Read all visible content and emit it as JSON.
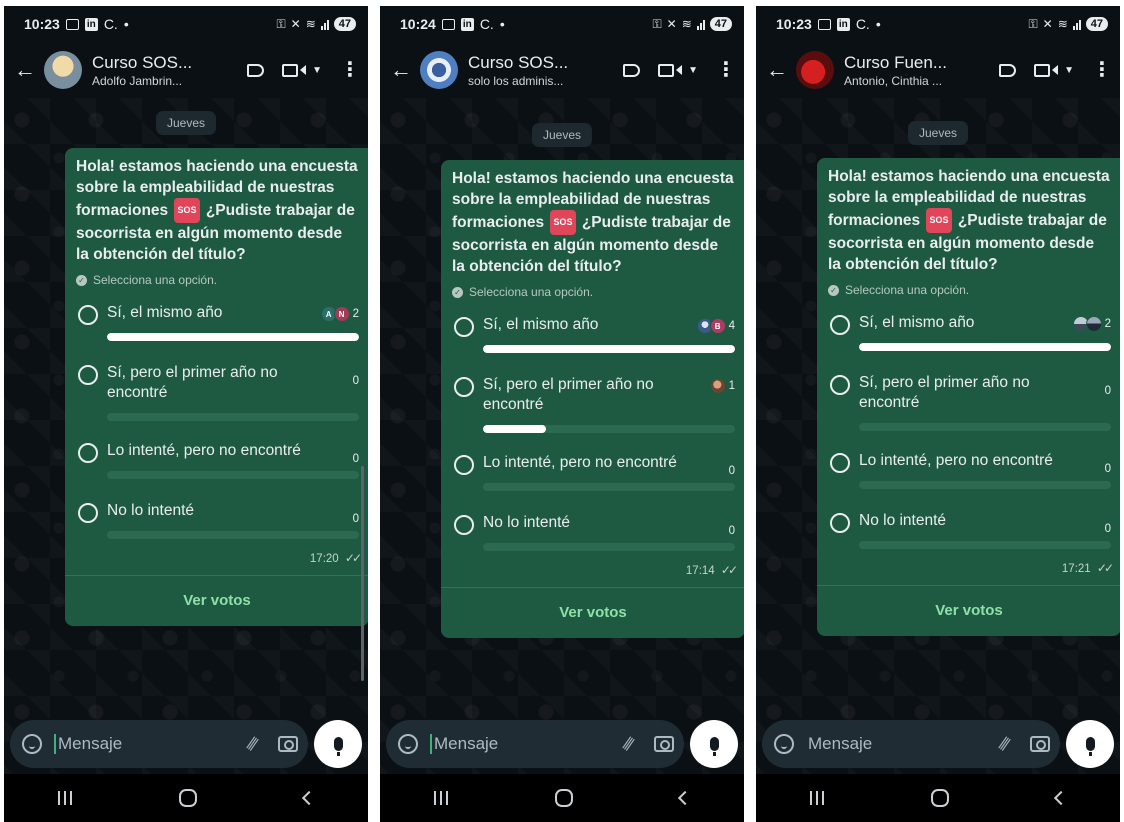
{
  "phones": [
    {
      "status": {
        "time": "10:23",
        "battery": "47"
      },
      "header": {
        "title": "Curso SOS...",
        "subtitle": "Adolfo Jambrin..."
      },
      "day_label": "Jueves",
      "system_note": "",
      "poll": {
        "question_before": "Hola! estamos haciendo una encuesta sobre la empleabilidad de nuestras formaciones",
        "sos_badge": "SOS",
        "question_after": "¿Pudiste trabajar de socorrista en algún momento desde la obtención del título?",
        "hint": "Selecciona una opción.",
        "options": [
          {
            "label": "Sí, el mismo año",
            "count": "2",
            "voter_initials": [
              "A",
              "N"
            ],
            "fraction": 1.0
          },
          {
            "label": "Sí, pero el primer año no encontré",
            "count": "0",
            "voter_initials": [],
            "fraction": 0
          },
          {
            "label": "Lo intenté, pero no encontré",
            "count": "0",
            "voter_initials": [],
            "fraction": 0
          },
          {
            "label": "No lo intenté",
            "count": "0",
            "voter_initials": [],
            "fraction": 0
          }
        ],
        "time": "17:20",
        "view_votes": "Ver votos"
      },
      "input_placeholder": "Mensaje"
    },
    {
      "status": {
        "time": "10:24",
        "battery": "47"
      },
      "header": {
        "title": "Curso SOS...",
        "subtitle": "solo los adminis..."
      },
      "day_label": "Jueves",
      "system_note": "",
      "poll": {
        "question_before": "Hola! estamos haciendo una encuesta sobre la empleabilidad de nuestras formaciones",
        "sos_badge": "SOS",
        "question_after": "¿Pudiste trabajar de socorrista en algún momento desde la obtención del título?",
        "hint": "Selecciona una opción.",
        "options": [
          {
            "label": "Sí, el mismo año",
            "count": "4",
            "voter_initials": [
              "",
              "B"
            ],
            "fraction": 1.0
          },
          {
            "label": "Sí, pero el primer año no encontré",
            "count": "1",
            "voter_initials": [
              ""
            ],
            "fraction": 0.25
          },
          {
            "label": "Lo intenté, pero no encontré",
            "count": "0",
            "voter_initials": [],
            "fraction": 0
          },
          {
            "label": "No lo intenté",
            "count": "0",
            "voter_initials": [],
            "fraction": 0
          }
        ],
        "time": "17:14",
        "view_votes": "Ver votos"
      },
      "input_placeholder": "Mensaje"
    },
    {
      "status": {
        "time": "10:23",
        "battery": "47"
      },
      "header": {
        "title": "Curso Fuen...",
        "subtitle": "Antonio, Cinthia ..."
      },
      "day_label": "Jueves",
      "system_note": "",
      "poll": {
        "question_before": "Hola! estamos haciendo una encuesta sobre la empleabilidad de nuestras formaciones",
        "sos_badge": "SOS",
        "question_after": "¿Pudiste trabajar de socorrista en algún momento desde la obtención del título?",
        "hint": "Selecciona una opción.",
        "options": [
          {
            "label": "Sí, el mismo año",
            "count": "2",
            "voter_initials": [
              "",
              ""
            ],
            "fraction": 1.0
          },
          {
            "label": "Sí, pero el primer año no encontré",
            "count": "0",
            "voter_initials": [],
            "fraction": 0
          },
          {
            "label": "Lo intenté, pero no encontré",
            "count": "0",
            "voter_initials": [],
            "fraction": 0
          },
          {
            "label": "No lo intenté",
            "count": "0",
            "voter_initials": [],
            "fraction": 0
          }
        ],
        "time": "17:21",
        "view_votes": "Ver votos"
      },
      "input_placeholder": "Mensaje"
    }
  ]
}
